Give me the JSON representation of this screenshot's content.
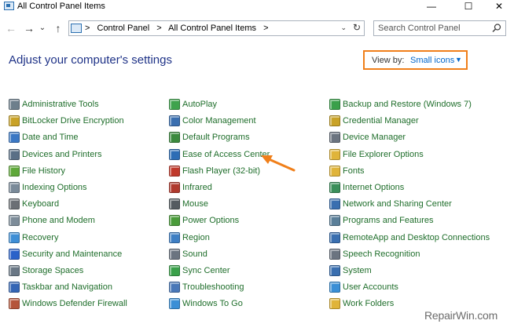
{
  "window": {
    "title": "All Control Panel Items",
    "controls": [
      "—",
      "☐",
      "✕"
    ]
  },
  "nav": {
    "back": "←",
    "forward": "→",
    "recent": "⌄",
    "up": "↑"
  },
  "address": {
    "breadcrumbs": [
      ">",
      "Control Panel",
      ">",
      "All Control Panel Items",
      ">"
    ],
    "dropdown": "⌄",
    "refresh": "↻"
  },
  "search": {
    "placeholder": "Search Control Panel"
  },
  "main": {
    "heading": "Adjust your computer's settings",
    "view_by_label": "View by:",
    "view_by_value": "Small icons",
    "view_by_caret": "▼"
  },
  "columns": [
    [
      {
        "label": "Administrative Tools",
        "icon": "tools-icon",
        "color": "#6d7f8c"
      },
      {
        "label": "BitLocker Drive Encryption",
        "icon": "bitlocker-icon",
        "color": "#c9a227"
      },
      {
        "label": "Date and Time",
        "icon": "clock-icon",
        "color": "#3b78c4"
      },
      {
        "label": "Devices and Printers",
        "icon": "printer-icon",
        "color": "#5a6f86"
      },
      {
        "label": "File History",
        "icon": "file-history-icon",
        "color": "#5fa83a"
      },
      {
        "label": "Indexing Options",
        "icon": "indexing-icon",
        "color": "#7a8a99"
      },
      {
        "label": "Keyboard",
        "icon": "keyboard-icon",
        "color": "#6b6f75"
      },
      {
        "label": "Phone and Modem",
        "icon": "phone-icon",
        "color": "#7d8c99"
      },
      {
        "label": "Recovery",
        "icon": "recovery-icon",
        "color": "#3f8fd6"
      },
      {
        "label": "Security and Maintenance",
        "icon": "flag-icon",
        "color": "#2a62c9"
      },
      {
        "label": "Storage Spaces",
        "icon": "storage-icon",
        "color": "#6a7886"
      },
      {
        "label": "Taskbar and Navigation",
        "icon": "taskbar-icon",
        "color": "#3566b5"
      },
      {
        "label": "Windows Defender Firewall",
        "icon": "firewall-icon",
        "color": "#b5553a"
      }
    ],
    [
      {
        "label": "AutoPlay",
        "icon": "autoplay-icon",
        "color": "#3fa34d"
      },
      {
        "label": "Color Management",
        "icon": "monitor-icon",
        "color": "#3a6fb0"
      },
      {
        "label": "Default Programs",
        "icon": "default-programs-icon",
        "color": "#3b8a3e"
      },
      {
        "label": "Ease of Access Center",
        "icon": "ease-of-access-icon",
        "color": "#2d6db5"
      },
      {
        "label": "Flash Player (32-bit)",
        "icon": "flash-icon",
        "color": "#c0392b"
      },
      {
        "label": "Infrared",
        "icon": "infrared-icon",
        "color": "#b03a2e"
      },
      {
        "label": "Mouse",
        "icon": "mouse-icon",
        "color": "#555b61"
      },
      {
        "label": "Power Options",
        "icon": "power-icon",
        "color": "#4a9b3a"
      },
      {
        "label": "Region",
        "icon": "globe-icon",
        "color": "#3f7fc4"
      },
      {
        "label": "Sound",
        "icon": "speaker-icon",
        "color": "#6b7480"
      },
      {
        "label": "Sync Center",
        "icon": "sync-icon",
        "color": "#3aa04a"
      },
      {
        "label": "Troubleshooting",
        "icon": "troubleshooting-icon",
        "color": "#4a78b8"
      },
      {
        "label": "Windows To Go",
        "icon": "windows-to-go-icon",
        "color": "#3a8fd6"
      }
    ],
    [
      {
        "label": "Backup and Restore (Windows 7)",
        "icon": "backup-icon",
        "color": "#3aa04a"
      },
      {
        "label": "Credential Manager",
        "icon": "credential-icon",
        "color": "#c9a227"
      },
      {
        "label": "Device Manager",
        "icon": "device-manager-icon",
        "color": "#6b7480"
      },
      {
        "label": "File Explorer Options",
        "icon": "folder-options-icon",
        "color": "#e0b43a"
      },
      {
        "label": "Fonts",
        "icon": "fonts-icon",
        "color": "#e0b43a"
      },
      {
        "label": "Internet Options",
        "icon": "internet-icon",
        "color": "#3a8f5a"
      },
      {
        "label": "Network and Sharing Center",
        "icon": "network-icon",
        "color": "#3a6fb0"
      },
      {
        "label": "Programs and Features",
        "icon": "programs-icon",
        "color": "#5a7f99"
      },
      {
        "label": "RemoteApp and Desktop Connections",
        "icon": "remoteapp-icon",
        "color": "#3a6fb0"
      },
      {
        "label": "Speech Recognition",
        "icon": "microphone-icon",
        "color": "#6b7480"
      },
      {
        "label": "System",
        "icon": "system-icon",
        "color": "#3a6fb0"
      },
      {
        "label": "User Accounts",
        "icon": "user-accounts-icon",
        "color": "#3a8fd6"
      },
      {
        "label": "Work Folders",
        "icon": "work-folders-icon",
        "color": "#e0b43a"
      }
    ]
  ],
  "watermark": "RepairWin.com",
  "accent": "#f07f1a",
  "link_color": "#1f6e2b"
}
